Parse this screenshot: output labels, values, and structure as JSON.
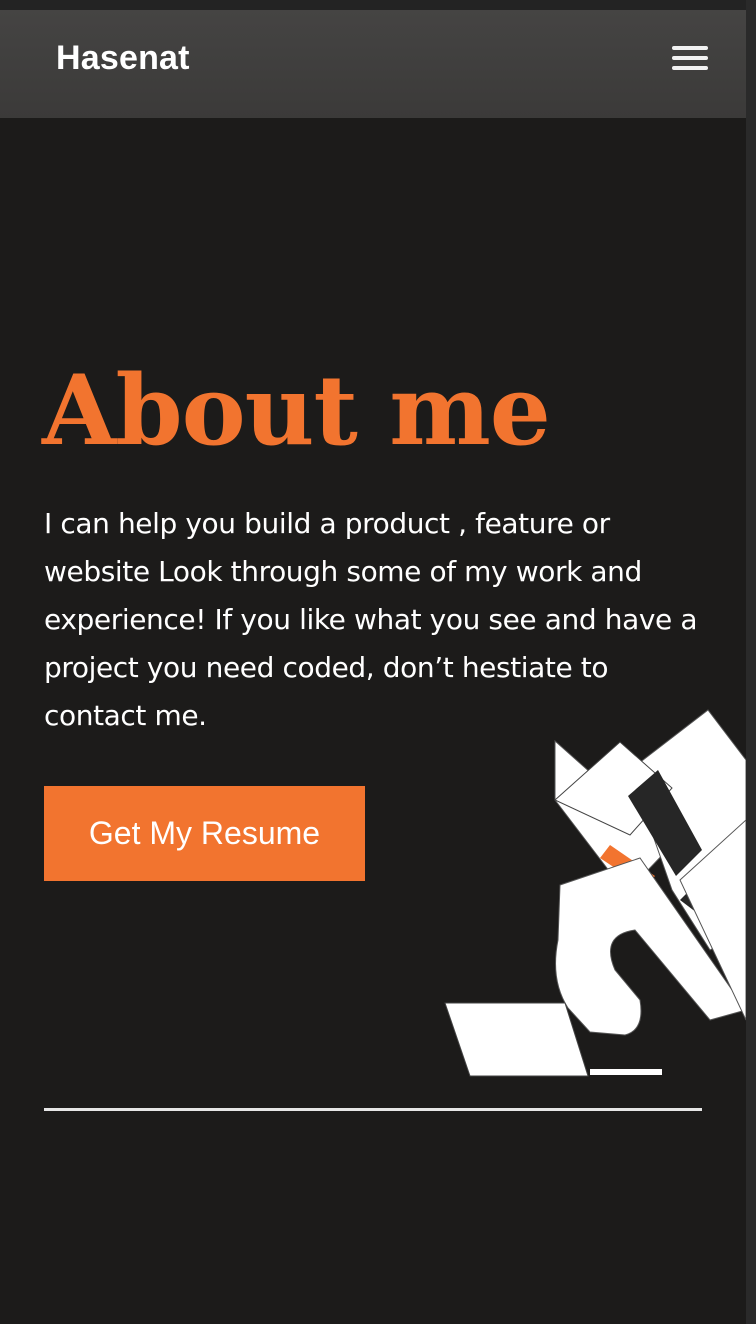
{
  "header": {
    "brand": "Hasenat",
    "menu_icon": "hamburger-menu-icon"
  },
  "hero": {
    "title": "About me",
    "description": "I can help you build a product , feature or website Look through some of my work and experience! If you like what you see and have a project you need coded, don’t hestiate to contact me.",
    "button_label": "Get My Resume"
  },
  "colors": {
    "background": "#1c1b1a",
    "navbar": "#403f3e",
    "accent": "#f2742f",
    "text": "#ffffff"
  },
  "illustration": {
    "icon": "abstract-geometric-illustration"
  }
}
